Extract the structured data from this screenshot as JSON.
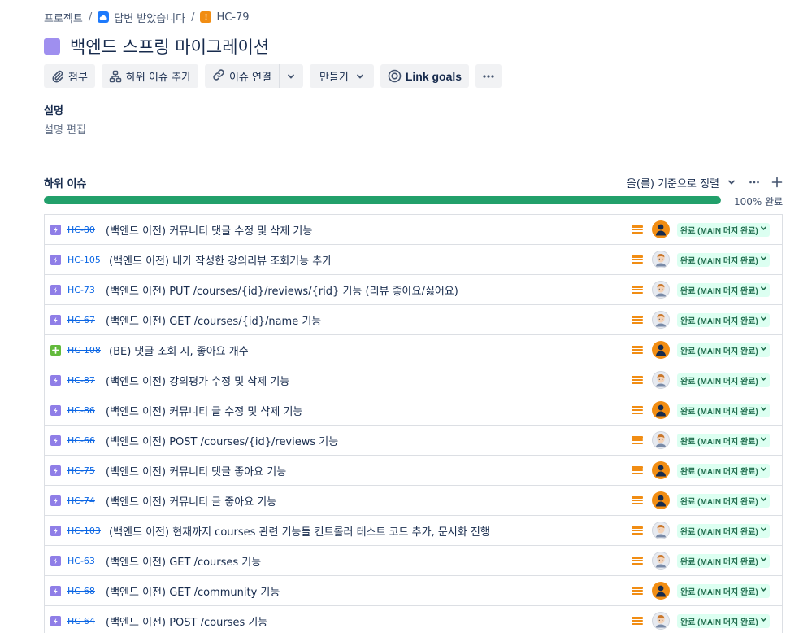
{
  "breadcrumb": {
    "project": "프로젝트",
    "parent": "답변 받았습니다",
    "issue": "HC-79",
    "separator": "/"
  },
  "page": {
    "title": "백엔드 스프링 마이그레이션"
  },
  "toolbar": {
    "attach": "첨부",
    "add_child": "하위 이슈 추가",
    "link_issue": "이슈 연결",
    "create": "만들기",
    "link_goals": "Link goals"
  },
  "description": {
    "label": "설명",
    "edit": "설명 편집"
  },
  "child_issues": {
    "title": "하위 이슈",
    "sort_label": "을(를) 기준으로 정렬",
    "progress_percent": 100,
    "progress_text": "100% 완료",
    "status_label": "완료 (MAIN 머지 완료)",
    "items": [
      {
        "key": "HC-80",
        "summary": "(백엔드 이전) 커뮤니티 댓글 수정 및 삭제 기능",
        "type": "purple",
        "avatar": "orange"
      },
      {
        "key": "HC-105",
        "summary": "(백엔드 이전) 내가 작성한 강의리뷰 조회기능 추가",
        "type": "purple",
        "avatar": "photo"
      },
      {
        "key": "HC-73",
        "summary": "(백엔드 이전) PUT /courses/{id}/reviews/{rid} 기능 (리뷰 좋아요/싫어요)",
        "type": "purple",
        "avatar": "photo"
      },
      {
        "key": "HC-67",
        "summary": "(백엔드 이전) GET /courses/{id}/name 기능",
        "type": "purple",
        "avatar": "photo"
      },
      {
        "key": "HC-108",
        "summary": "(BE) 댓글 조회 시, 좋아요 개수",
        "type": "green",
        "avatar": "orange"
      },
      {
        "key": "HC-87",
        "summary": "(백엔드 이전) 강의평가 수정 및 삭제 기능",
        "type": "purple",
        "avatar": "photo"
      },
      {
        "key": "HC-86",
        "summary": "(백엔드 이전) 커뮤니티 글 수정 및 삭제 기능",
        "type": "purple",
        "avatar": "orange"
      },
      {
        "key": "HC-66",
        "summary": "(백엔드 이전) POST /courses/{id}/reviews 기능",
        "type": "purple",
        "avatar": "photo"
      },
      {
        "key": "HC-75",
        "summary": "(백엔드 이전) 커뮤니티 댓글 좋아요 기능",
        "type": "purple",
        "avatar": "orange"
      },
      {
        "key": "HC-74",
        "summary": "(백엔드 이전) 커뮤니티 글 좋아요 기능",
        "type": "purple",
        "avatar": "orange"
      },
      {
        "key": "HC-103",
        "summary": "(백엔드 이전) 현재까지 courses 관련 기능들 컨트롤러 테스트 코드 추가, 문서화 진행",
        "type": "purple",
        "avatar": "photo"
      },
      {
        "key": "HC-63",
        "summary": "(백엔드 이전) GET /courses 기능",
        "type": "purple",
        "avatar": "photo"
      },
      {
        "key": "HC-68",
        "summary": "(백엔드 이전) GET /community 기능",
        "type": "purple",
        "avatar": "orange"
      },
      {
        "key": "HC-64",
        "summary": "(백엔드 이전) POST /courses 기능",
        "type": "purple",
        "avatar": "photo"
      }
    ]
  },
  "colors": {
    "progress": "#22a06b",
    "status_bg": "#dcfff1",
    "status_text": "#216e4e",
    "priority": "#f18d13",
    "story_icon": "#8f7ee7",
    "task_icon": "#63ba3c",
    "link": "#0c66e4"
  },
  "icons": {
    "attach": "paperclip-icon",
    "add_child": "hierarchy-icon",
    "link": "link-icon",
    "goals": "target-icon",
    "more": "more-icon",
    "priority": "priority-medium-icon"
  }
}
